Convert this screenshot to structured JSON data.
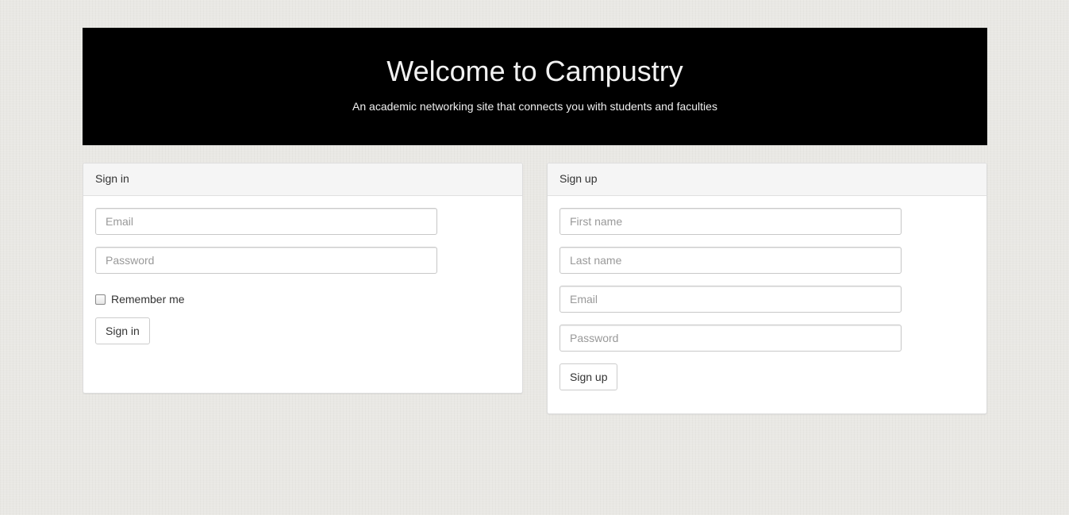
{
  "hero": {
    "title": "Welcome to Campustry",
    "subtitle": "An academic networking site that connects you with students and faculties"
  },
  "signin": {
    "heading": "Sign in",
    "email_placeholder": "Email",
    "password_placeholder": "Password",
    "remember_label": "Remember me",
    "button_label": "Sign in"
  },
  "signup": {
    "heading": "Sign up",
    "first_name_placeholder": "First name",
    "last_name_placeholder": "Last name",
    "email_placeholder": "Email",
    "password_placeholder": "Password",
    "button_label": "Sign up"
  }
}
